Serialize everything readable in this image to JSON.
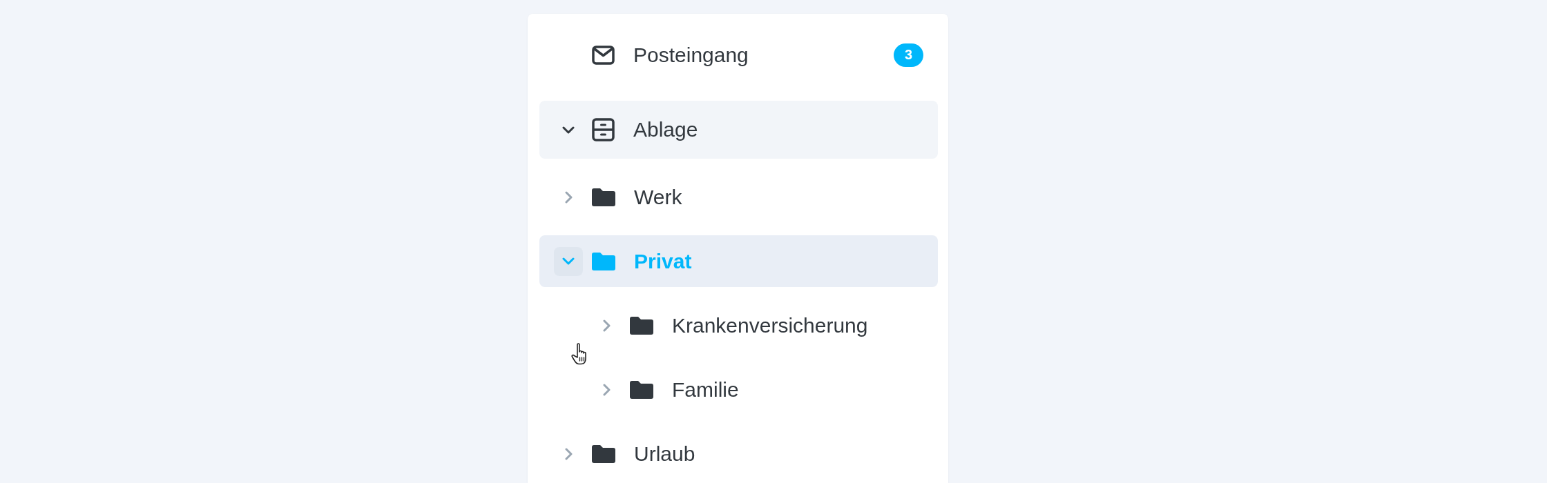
{
  "nav": [
    {
      "kind": "inbox",
      "label": "Posteingang",
      "count": "3",
      "selected": false
    },
    {
      "kind": "archive",
      "label": "Ablage",
      "expanded": true,
      "selected": false,
      "children": [
        {
          "kind": "folder",
          "label": "Werk",
          "expanded": false,
          "selected": false
        },
        {
          "kind": "folder",
          "label": "Privat",
          "expanded": true,
          "selected": true,
          "children": [
            {
              "kind": "folder",
              "label": "Krankenversicherung",
              "expanded": false,
              "selected": false
            },
            {
              "kind": "folder",
              "label": "Familie",
              "expanded": false,
              "selected": false
            }
          ]
        },
        {
          "kind": "folder",
          "label": "Urlaub",
          "expanded": false,
          "selected": false
        }
      ]
    }
  ]
}
